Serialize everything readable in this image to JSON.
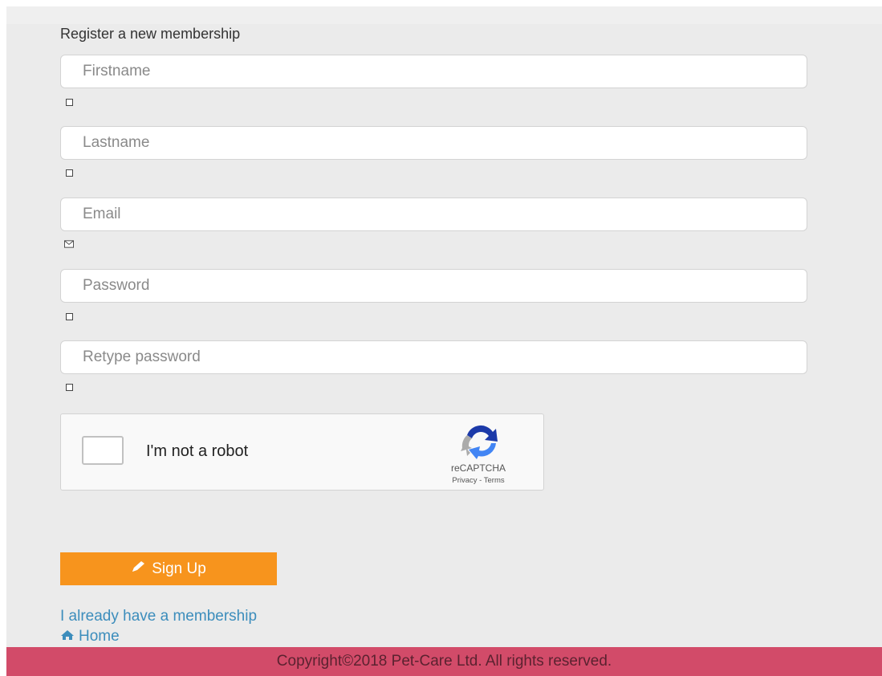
{
  "form": {
    "title": "Register a new membership",
    "fields": [
      {
        "name": "firstname",
        "placeholder": "Firstname",
        "value": ""
      },
      {
        "name": "lastname",
        "placeholder": "Lastname",
        "value": ""
      },
      {
        "name": "email",
        "placeholder": "Email",
        "value": ""
      },
      {
        "name": "password",
        "placeholder": "Password",
        "value": ""
      },
      {
        "name": "retype_password",
        "placeholder": "Retype password",
        "value": ""
      }
    ]
  },
  "captcha": {
    "label": "I'm not a robot",
    "brand": "reCAPTCHA",
    "links": "Privacy - Terms",
    "logo_icon": "recaptcha-logo-icon",
    "checked": false
  },
  "actions": {
    "signup_label": "Sign Up",
    "signup_icon": "pencil-icon",
    "login_link": "I already have a membership",
    "home_link": "Home",
    "home_icon": "home-icon"
  },
  "footer": {
    "text": "Copyright©2018 Pet-Care Ltd. All rights reserved."
  },
  "colors": {
    "signup_button": "#f7941d",
    "link": "#3c8dbc",
    "footer": "#d24b69"
  }
}
